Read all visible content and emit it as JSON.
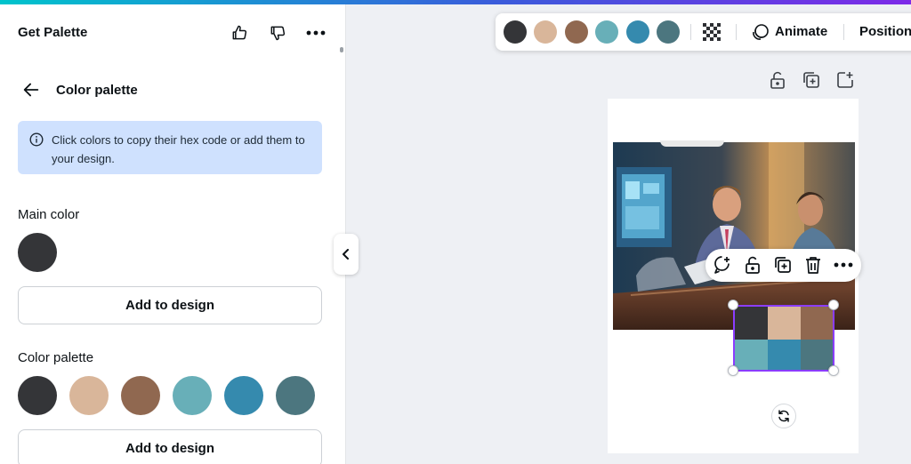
{
  "app": {
    "title": "Get Palette"
  },
  "header": {
    "like_icon": "thumbs-up-icon",
    "dislike_icon": "thumbs-down-icon",
    "more_icon": "more-dots-icon"
  },
  "panel": {
    "subtitle": "Color palette",
    "info_text": "Click colors to copy their hex code or add them to your design.",
    "main_color_label": "Main color",
    "main_color": "#343538",
    "add_button_label": "Add to design",
    "palette_label": "Color palette",
    "palette_colors": [
      "#343538",
      "#d9b69a",
      "#906850",
      "#68afb8",
      "#358aae",
      "#4c767f"
    ]
  },
  "toolbar": {
    "animate_label": "Animate",
    "position_label": "Position",
    "transparency_icon": "transparency-icon",
    "animate_icon": "animate-icon"
  },
  "colors": {
    "accent": "#8b3dff",
    "info_bg": "#cfe1fe"
  }
}
